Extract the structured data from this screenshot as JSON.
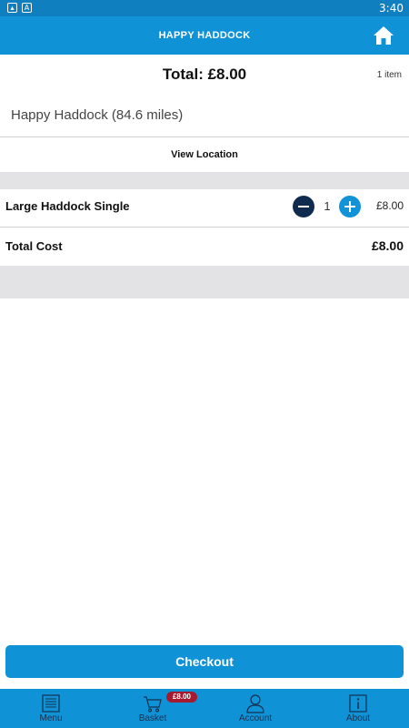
{
  "status_bar": {
    "time": "3:40",
    "icons": [
      "image-icon",
      "a-icon"
    ]
  },
  "app_bar": {
    "title": "HAPPY HADDOCK",
    "home_icon": "home-icon"
  },
  "basket": {
    "total_label": "Total: £8.00",
    "item_count": "1 item",
    "shop_name": "Happy Haddock (84.6 miles)",
    "view_location_label": "View Location",
    "items": [
      {
        "name": "Large Haddock Single",
        "quantity": "1",
        "price": "£8.00"
      }
    ],
    "total_cost_label": "Total Cost",
    "total_cost_value": "£8.00"
  },
  "checkout_label": "Checkout",
  "bottom_nav": {
    "items": [
      {
        "label": "Menu",
        "icon": "menu-book-icon"
      },
      {
        "label": "Basket",
        "icon": "basket-icon"
      },
      {
        "label": "Account",
        "icon": "account-icon"
      },
      {
        "label": "About",
        "icon": "info-icon"
      }
    ],
    "basket_badge": "£8.00"
  },
  "colors": {
    "primary": "#0f93d6",
    "status_bar": "#0f7fbf",
    "minus_button": "#0f2c4e",
    "badge": "#a6192e",
    "nav_icon": "#15304f"
  }
}
